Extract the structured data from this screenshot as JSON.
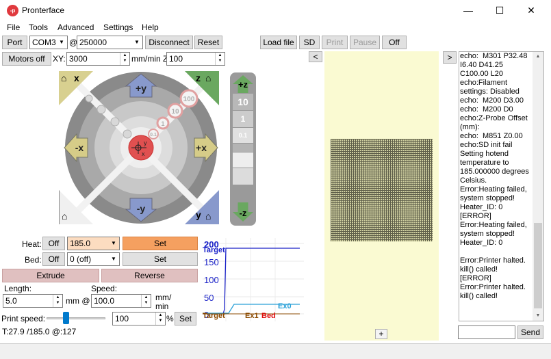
{
  "window": {
    "title": "Pronterface",
    "icon_text": "-p"
  },
  "menu": [
    "File",
    "Tools",
    "Advanced",
    "Settings",
    "Help"
  ],
  "toolbar": {
    "port_label": "Port",
    "port_value": "COM3",
    "at": "@",
    "baud_value": "250000",
    "disconnect": "Disconnect",
    "reset": "Reset",
    "load_file": "Load file",
    "sd": "SD",
    "print": "Print",
    "pause": "Pause",
    "off": "Off"
  },
  "motors": {
    "motors_off": "Motors off",
    "xy_label": "XY:",
    "xy_value": "3000",
    "unit_z": "mm/min Z:",
    "z_value": "100"
  },
  "jog": {
    "home_x": "x",
    "plus_y": "+y",
    "home_z": "z",
    "minus_x": "-x",
    "plus_x": "+x",
    "minus_y": "-y",
    "home_y": "y",
    "step_100": "100",
    "step_10": "10",
    "step_1": "1",
    "step_01": "0.1",
    "center_y": "y",
    "center_x": "x",
    "plus_z": "+z",
    "minus_z": "-z",
    "z10": "10",
    "z1": "1",
    "z01": "0.1"
  },
  "temps": {
    "heat_label": "Heat:",
    "heat_off": "Off",
    "heat_value": "185.0",
    "heat_set": "Set",
    "bed_label": "Bed:",
    "bed_off": "Off",
    "bed_value": "0 (off)",
    "bed_set": "Set"
  },
  "extrude": {
    "extrude": "Extrude",
    "reverse": "Reverse",
    "length_label": "Length:",
    "length_value": "5.0",
    "mm_at": "mm @",
    "speed_label": "Speed:",
    "speed_value": "100.0",
    "speed_unit_1": "mm/",
    "speed_unit_2": "min",
    "print_speed_label": "Print speed:",
    "print_speed_value": "100",
    "percent": "%",
    "set": "Set",
    "print_speed_fraction": 0.33,
    "status": "T:27.9 /185.0 @:127"
  },
  "graph": {
    "yticks": [
      "200",
      "150",
      "100",
      "50",
      "0"
    ],
    "target_top": "Target",
    "ex0": "Ex0",
    "target_bottom": "Target",
    "ex1": "Ex1",
    "bed": "Bed",
    "colors": {
      "target": "#1a22c8",
      "ex0": "#2aa0d8",
      "ex1": "#8b4a00",
      "bed": "#e01010"
    }
  },
  "panes": {
    "collapse": "<",
    "expand": ">",
    "add": "+"
  },
  "console": {
    "lines": [
      "echo:  M301 P32.48",
      "I6.40 D41.25",
      "C100.00 L20",
      "echo:Filament",
      "settings: Disabled",
      "echo:  M200 D3.00",
      "echo:  M200 D0",
      "echo:Z-Probe Offset",
      "(mm):",
      "echo:  M851 Z0.00",
      "echo:SD init fail",
      "Setting hotend",
      "temperature to",
      "185.000000 degrees",
      "Celsius.",
      "Error:Heating failed,",
      "system stopped!",
      "Heater_ID: 0",
      "[ERROR]",
      "Error:Heating failed,",
      "system stopped!",
      "Heater_ID: 0",
      "",
      "Error:Printer halted.",
      "kill() called!",
      "[ERROR]",
      "Error:Printer halted.",
      "kill() called!"
    ],
    "send": "Send",
    "input_value": ""
  }
}
